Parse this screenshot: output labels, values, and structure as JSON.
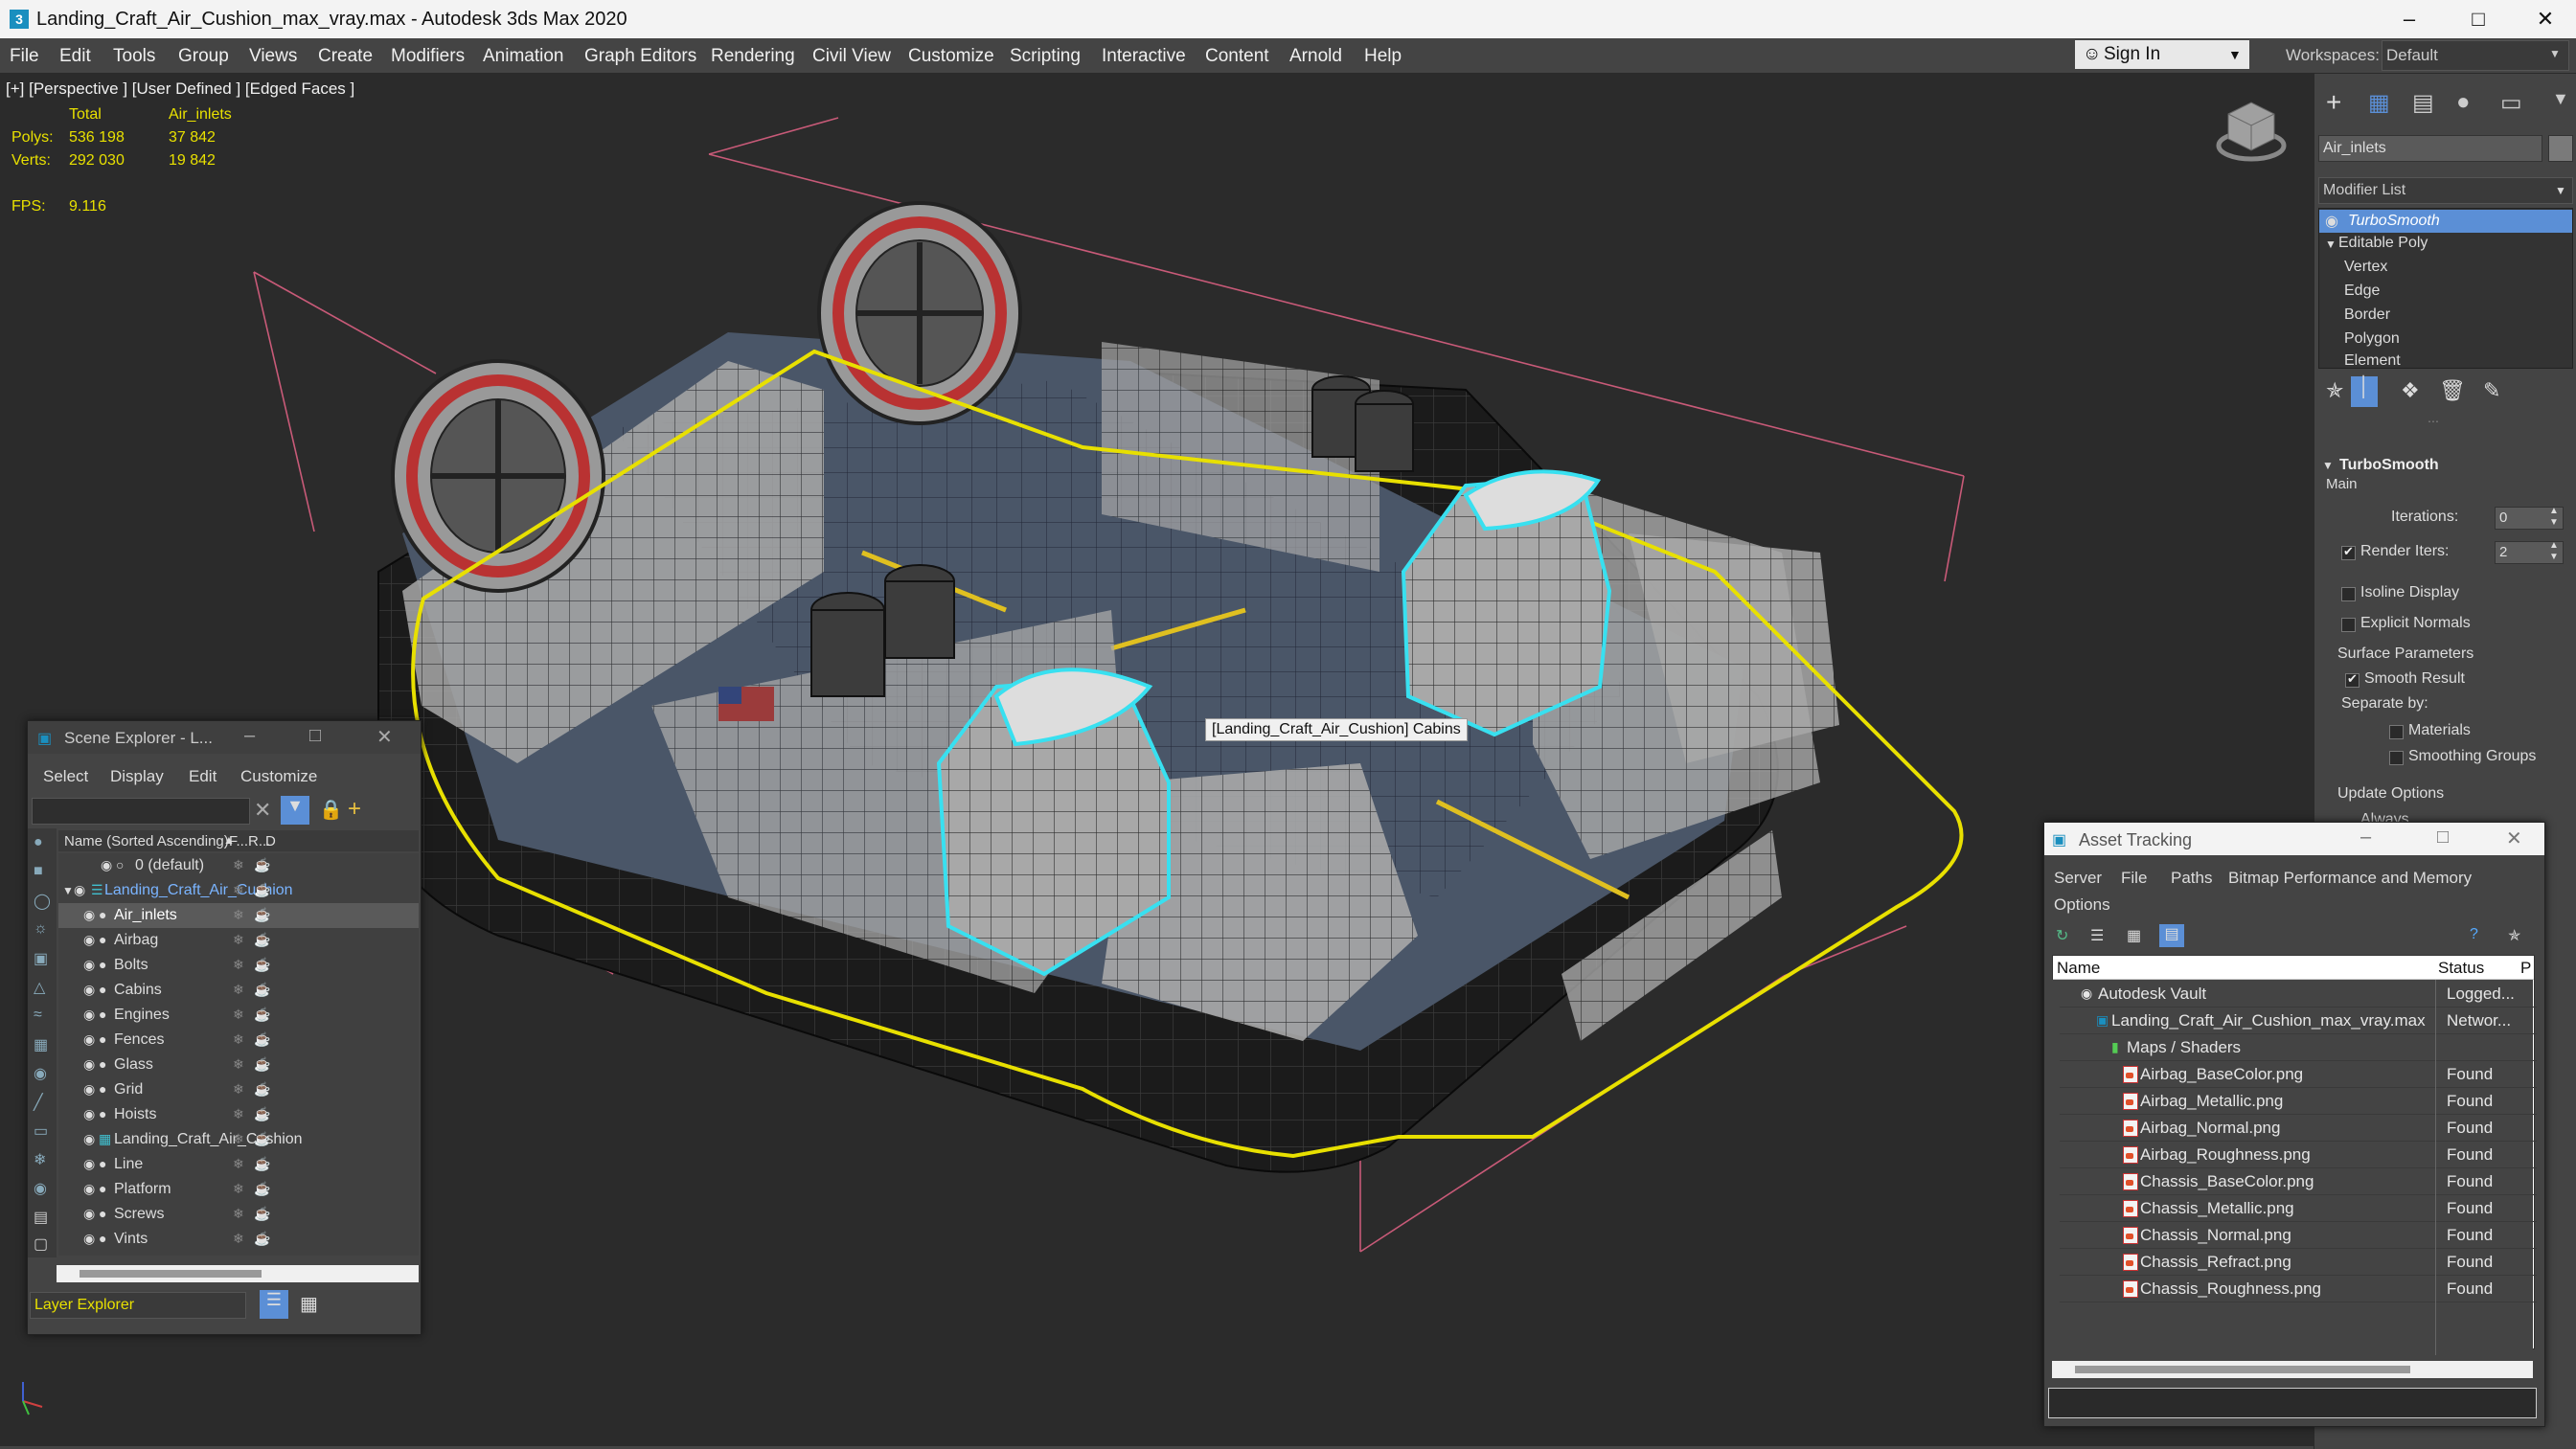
{
  "window": {
    "title": "Landing_Craft_Air_Cushion_max_vray.max - Autodesk 3ds Max 2020"
  },
  "menu": [
    "File",
    "Edit",
    "Tools",
    "Group",
    "Views",
    "Create",
    "Modifiers",
    "Animation",
    "Graph Editors",
    "Rendering",
    "Civil View",
    "Customize",
    "Scripting",
    "Interactive",
    "Content",
    "Arnold",
    "Help"
  ],
  "signin": "Sign In",
  "workspaces": {
    "label": "Workspaces:",
    "value": "Default"
  },
  "viewport": {
    "label": "[+] [Perspective ] [User Defined ] [Edged Faces ]",
    "stats": {
      "total": "Total",
      "selected": "Air_inlets",
      "polys_label": "Polys:",
      "polys_total": "536 198",
      "polys_sel": "37 842",
      "verts_label": "Verts:",
      "verts_total": "292 030",
      "verts_sel": "19 842",
      "fps_label": "FPS:",
      "fps": "9.116"
    },
    "tooltip": "[Landing_Craft_Air_Cushion] Cabins"
  },
  "command_panel": {
    "object_name": "Air_inlets",
    "modifier_list": "Modifier List",
    "stack": [
      "TurboSmooth",
      "Editable Poly",
      "Vertex",
      "Edge",
      "Border",
      "Polygon",
      "Element"
    ],
    "rollout_title": "TurboSmooth",
    "main": "Main",
    "iterations_label": "Iterations:",
    "iterations": "0",
    "render_iters_label": "Render Iters:",
    "render_iters": "2",
    "isoline": "Isoline Display",
    "explicit_normals": "Explicit Normals",
    "surface_params": "Surface Parameters",
    "smooth_result": "Smooth Result",
    "separate_by": "Separate by:",
    "materials": "Materials",
    "smoothing_groups": "Smoothing Groups",
    "update_options": "Update Options",
    "always": "Always"
  },
  "scene_explorer": {
    "title": "Scene Explorer - L...",
    "menu": [
      "Select",
      "Display",
      "Edit",
      "Customize"
    ],
    "columns": {
      "name": "Name (Sorted Ascending)",
      "f": "F...",
      "r": "R...",
      "d": "D"
    },
    "rows": [
      "0 (default)",
      "Landing_Craft_Air_Cushion",
      "Air_inlets",
      "Airbag",
      "Bolts",
      "Cabins",
      "Engines",
      "Fences",
      "Glass",
      "Grid",
      "Hoists",
      "Landing_Craft_Air_Cushion",
      "Line",
      "Platform",
      "Screws",
      "Vints"
    ],
    "footer": "Layer Explorer"
  },
  "asset_tracking": {
    "title": "Asset Tracking",
    "menu": [
      "Server",
      "File",
      "Paths",
      "Bitmap Performance and Memory",
      "Options"
    ],
    "columns": {
      "name": "Name",
      "status": "Status",
      "p": "P"
    },
    "rows": [
      {
        "name": "Autodesk Vault",
        "status": "Logged..."
      },
      {
        "name": "Landing_Craft_Air_Cushion_max_vray.max",
        "status": "Networ..."
      },
      {
        "name": "Maps / Shaders",
        "status": ""
      },
      {
        "name": "Airbag_BaseColor.png",
        "status": "Found"
      },
      {
        "name": "Airbag_Metallic.png",
        "status": "Found"
      },
      {
        "name": "Airbag_Normal.png",
        "status": "Found"
      },
      {
        "name": "Airbag_Roughness.png",
        "status": "Found"
      },
      {
        "name": "Chassis_BaseColor.png",
        "status": "Found"
      },
      {
        "name": "Chassis_Metallic.png",
        "status": "Found"
      },
      {
        "name": "Chassis_Normal.png",
        "status": "Found"
      },
      {
        "name": "Chassis_Refract.png",
        "status": "Found"
      },
      {
        "name": "Chassis_Roughness.png",
        "status": "Found"
      }
    ]
  },
  "colors": {
    "selection_cyan": "#38e0f0",
    "highlight_yellow": "#e8e000",
    "active_blue": "#5b8fd6"
  }
}
